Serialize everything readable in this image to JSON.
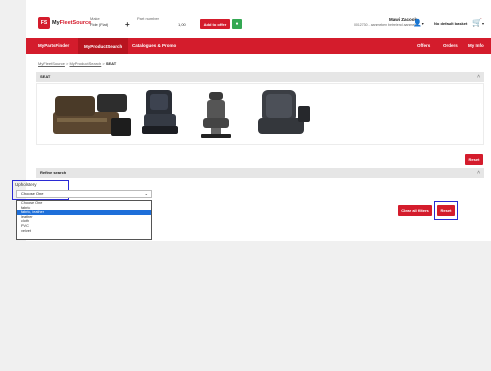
{
  "header": {
    "logo_badge": "FS",
    "logo_prefix": "My",
    "logo_brand": "FleetSource",
    "make_label": "Make",
    "make_value": "Fide (Fiat)",
    "part_label": "Part number",
    "quantity": "1,00",
    "add_offer_label": "Add to offer",
    "user_name": "Mawi Zacook",
    "user_sub": "0012730 - aanmeken betreiend aanmele",
    "basket_label": "No default basket"
  },
  "nav": {
    "items": [
      "MyPartsFinder",
      "MyProductSearch",
      "Catalogues & Promo"
    ],
    "right_items": [
      "Offers",
      "Orders",
      "My Info"
    ]
  },
  "breadcrumb": [
    "MyFleetSource",
    "MyProductSearch",
    "SEAT"
  ],
  "seat_panel": {
    "title": "SEAT"
  },
  "refine": {
    "reset_top_label": "Reset",
    "title": "Refine search",
    "upholstery_label": "Upholstery",
    "select_value": "Choose One",
    "options": [
      "Choose One",
      "fabric",
      "fabric, leather",
      "leather",
      "cloth",
      "PVC",
      "velvet"
    ],
    "selected_index": 2,
    "clear_label": "Clear all filters",
    "reset_label": "Reset"
  },
  "colors": {
    "brand": "#d41c2c",
    "highlight": "#2a2ad4",
    "selected": "#1e6fd9"
  }
}
